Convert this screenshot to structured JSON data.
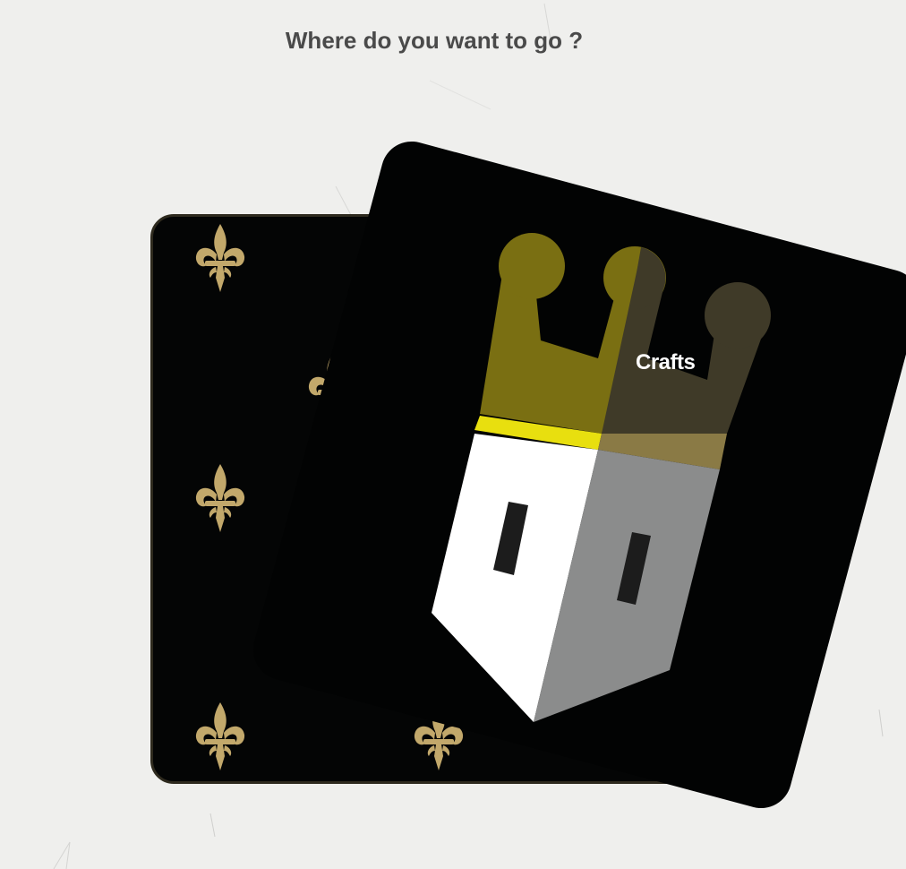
{
  "page": {
    "title": "Where do you want to go ?"
  },
  "cards": {
    "back": {
      "pattern_icon": "fleur-de-lis-icon",
      "pattern_color": "#c2a86b",
      "background": "#040505"
    },
    "front": {
      "label": "Crafts",
      "icon": "castle-crown-icon",
      "crown_color": "#7a6f12",
      "crown_shade_color": "#3f3a28",
      "band_color": "#e8df0f",
      "wall_light_color": "#ffffff",
      "wall_shade_color": "#8b8c8c",
      "background": "#020303"
    }
  }
}
